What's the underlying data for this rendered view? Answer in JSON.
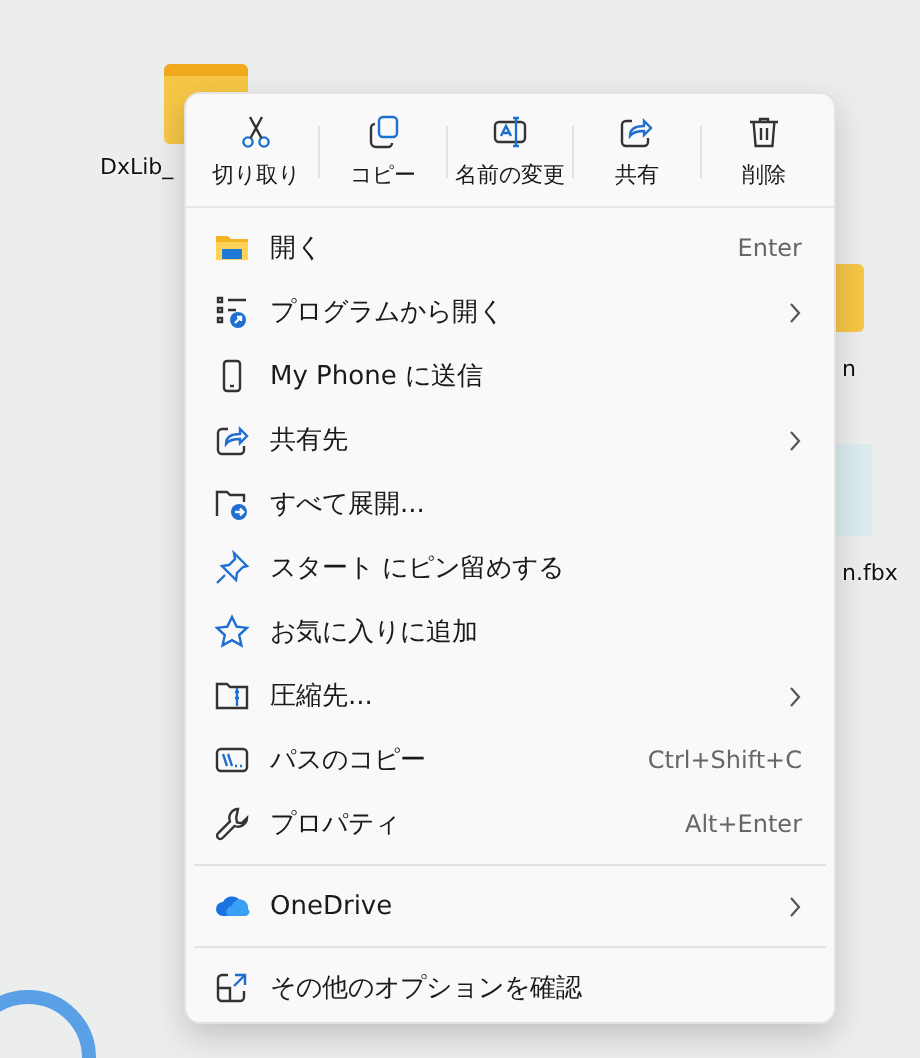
{
  "desktop_icons": [
    {
      "label": "DxLib_"
    },
    {
      "label": "n"
    },
    {
      "label": "n.fbx"
    }
  ],
  "context_menu": {
    "toolbar": [
      {
        "label": "切り取り"
      },
      {
        "label": "コピー"
      },
      {
        "label": "名前の変更"
      },
      {
        "label": "共有"
      },
      {
        "label": "削除"
      }
    ],
    "items": [
      {
        "kind": "item",
        "label": "開く",
        "shortcut": "Enter",
        "has_submenu": false
      },
      {
        "kind": "item",
        "label": "プログラムから開く",
        "has_submenu": true
      },
      {
        "kind": "item",
        "label": "My Phone に送信",
        "has_submenu": false
      },
      {
        "kind": "item",
        "label": "共有先",
        "has_submenu": true
      },
      {
        "kind": "item",
        "label": "すべて展開...",
        "has_submenu": false
      },
      {
        "kind": "item",
        "label": "スタート にピン留めする",
        "has_submenu": false
      },
      {
        "kind": "item",
        "label": "お気に入りに追加",
        "has_submenu": false
      },
      {
        "kind": "item",
        "label": "圧縮先...",
        "has_submenu": true
      },
      {
        "kind": "item",
        "label": "パスのコピー",
        "shortcut": "Ctrl+Shift+C",
        "has_submenu": false
      },
      {
        "kind": "item",
        "label": "プロパティ",
        "shortcut": "Alt+Enter",
        "has_submenu": false
      },
      {
        "kind": "separator"
      },
      {
        "kind": "item",
        "label": "OneDrive",
        "has_submenu": true
      },
      {
        "kind": "separator"
      },
      {
        "kind": "item",
        "label": "その他のオプションを確認",
        "has_submenu": false
      }
    ]
  }
}
